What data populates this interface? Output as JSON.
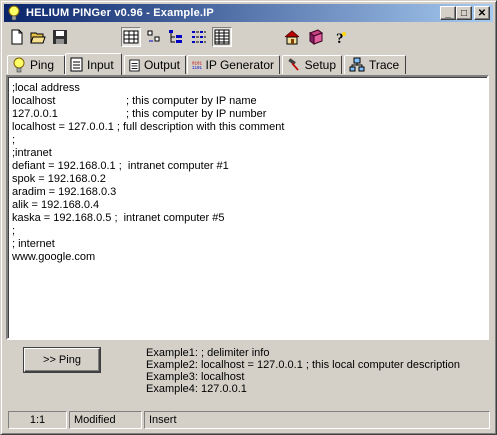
{
  "window": {
    "title": "HELIUM PINGer  v0.96  - Example.IP",
    "minimize": "_",
    "maximize": "□",
    "close": "✕"
  },
  "toolbar": {
    "buttons": [
      "new-file-icon",
      "open-folder-icon",
      "save-icon",
      "view-grid-icon",
      "view-small-icons-icon",
      "view-tree-icon",
      "view-list-icon",
      "view-details-icon",
      "home-icon",
      "book-icon",
      "help-icon"
    ]
  },
  "tabs": [
    {
      "label": "Ping",
      "icon": "lightbulb-icon"
    },
    {
      "label": "Input",
      "icon": "notepad-icon",
      "active": true
    },
    {
      "label": "Output",
      "icon": "notepad-icon"
    },
    {
      "label": "IP Generator",
      "icon": "binary-icon"
    },
    {
      "label": "Setup",
      "icon": "hammer-icon"
    },
    {
      "label": "Trace",
      "icon": "network-icon"
    }
  ],
  "editor": {
    "lines": [
      {
        "a": ";local address",
        "b": ""
      },
      {
        "a": "localhost",
        "b": "; this computer by IP name"
      },
      {
        "a": "127.0.0.1",
        "b": "; this computer by IP number"
      },
      {
        "a": "localhost = 127.0.0.1 ; full description with this comment",
        "b": ""
      },
      {
        "a": ";",
        "b": ""
      },
      {
        "a": ";intranet",
        "b": ""
      },
      {
        "a": "defiant = 192.168.0.1 ;  intranet computer #1",
        "b": ""
      },
      {
        "a": "spok = 192.168.0.2",
        "b": ""
      },
      {
        "a": "aradim = 192.168.0.3",
        "b": ""
      },
      {
        "a": "alik = 192.168.0.4",
        "b": ""
      },
      {
        "a": "kaska = 192.168.0.5 ;  intranet computer #5",
        "b": ""
      },
      {
        "a": ";",
        "b": ""
      },
      {
        "a": "; internet",
        "b": ""
      },
      {
        "a": "www.google.com",
        "b": ""
      }
    ]
  },
  "ping_button": ">> Ping",
  "examples": [
    {
      "label": "Example1:",
      "value": "; delimiter info"
    },
    {
      "label": "Example2:",
      "value": "localhost = 127.0.0.1 ; this local computer description"
    },
    {
      "label": "Example3:",
      "value": "localhost"
    },
    {
      "label": "Example4:",
      "value": "127.0.0.1"
    }
  ],
  "status": {
    "position": "1:1",
    "modified": "Modified",
    "mode": "Insert"
  }
}
